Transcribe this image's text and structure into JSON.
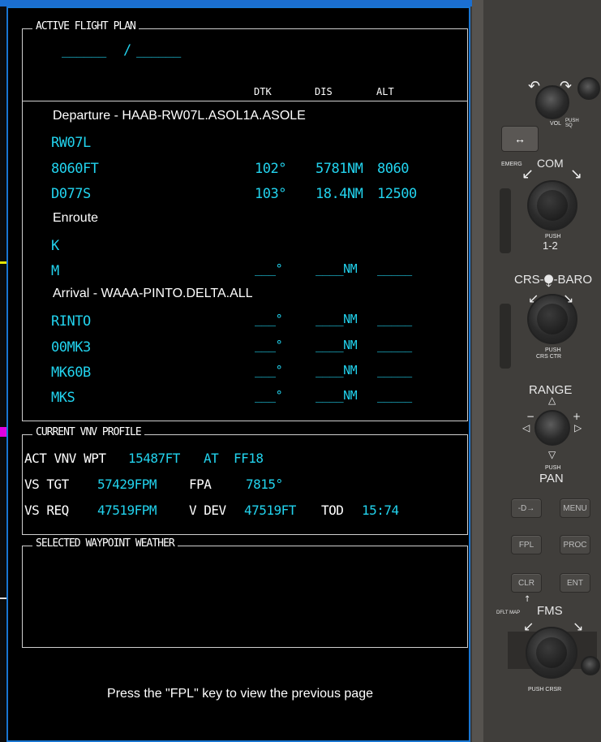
{
  "active_flight_plan": {
    "title": "ACTIVE FLIGHT PLAN",
    "route_left": "______",
    "route_sep": "/",
    "route_right": "______",
    "col_headers": {
      "dtk": "DTK",
      "dis": "DIS",
      "alt": "ALT"
    },
    "departure_label": "Departure - HAAB-RW07L.ASOL1A.ASOLE",
    "departure_rows": [
      {
        "wpt": "RW07L",
        "dtk": "",
        "dis": "",
        "alt": ""
      },
      {
        "wpt": "8060FT",
        "dtk": "102°",
        "dis": "5781NM",
        "alt": "8060"
      },
      {
        "wpt": "D077S",
        "dtk": "103°",
        "dis": "18.4NM",
        "alt": "12500"
      }
    ],
    "enroute_label": "Enroute",
    "enroute_rows": [
      {
        "wpt": "K",
        "dtk": "",
        "dis": "",
        "alt": ""
      },
      {
        "wpt": "M",
        "dtk": "___°",
        "dis": "____NM",
        "alt": "_____"
      }
    ],
    "arrival_label": "Arrival - WAAA-PINTO.DELTA.ALL",
    "arrival_rows": [
      {
        "wpt": "RINTO",
        "dtk": "___°",
        "dis": "____NM",
        "alt": "_____"
      },
      {
        "wpt": "00MK3",
        "dtk": "___°",
        "dis": "____NM",
        "alt": "_____"
      },
      {
        "wpt": "MK60B",
        "dtk": "___°",
        "dis": "____NM",
        "alt": "_____"
      },
      {
        "wpt": "MKS",
        "dtk": "___°",
        "dis": "____NM",
        "alt": "_____"
      }
    ]
  },
  "vnv_profile": {
    "title": "CURRENT VNV PROFILE",
    "act_label": "ACT VNV WPT",
    "act_alt": "15487FT",
    "act_at": "AT",
    "act_wpt": "FF18",
    "vs_tgt_label": "VS TGT",
    "vs_tgt": "57429FPM",
    "fpa_label": "FPA",
    "fpa": "7815°",
    "vs_req_label": "VS REQ",
    "vs_req": "47519FPM",
    "vdev_label": "V DEV",
    "vdev": "47519FT",
    "tod_label": "TOD",
    "tod": "15:74"
  },
  "weather": {
    "title": "SELECTED WAYPOINT WEATHER"
  },
  "footer_message": "Press the \"FPL\" key to view the previous page",
  "bezel": {
    "vol_label": "VOL",
    "push_sq": "PUSH SQ",
    "emerg": "EMERG",
    "com_label": "COM",
    "push_12_a": "PUSH",
    "push_12_b": "1-2",
    "crs_baro": "CRS-⧭-BARO",
    "push_crs_a": "PUSH",
    "push_crs_b": "CRS CTR",
    "range_label": "RANGE",
    "push_pan_a": "PUSH",
    "push_pan_b": "PAN",
    "btn_direct": "-D→",
    "btn_menu": "MENU",
    "btn_fpl": "FPL",
    "btn_proc": "PROC",
    "btn_clr": "CLR",
    "btn_ent": "ENT",
    "dflt_map": "DFLT MAP",
    "fms_label": "FMS",
    "push_crsr": "PUSH CRSR"
  },
  "colors": {
    "cyan": "#22d3ee",
    "frame_blue": "#1b6fd1",
    "bezel": "#403e3b"
  }
}
